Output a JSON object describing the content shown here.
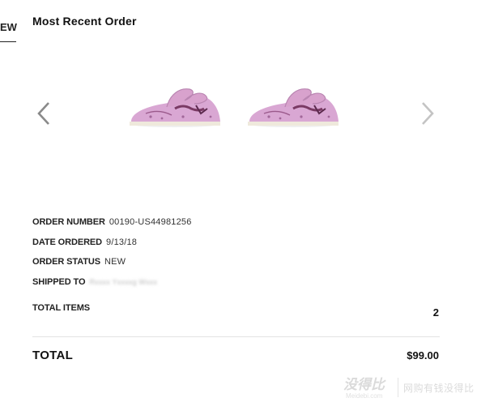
{
  "nav": {
    "left_tab_label": "EW"
  },
  "page": {
    "title": "Most Recent Order"
  },
  "carousel": {
    "prev_icon": "chevron-left-icon",
    "next_icon": "chevron-right-icon",
    "arrow_prev_color": "#8a8a8a",
    "arrow_next_color": "#c4c4c4",
    "shoe_color": "#d9a7d3"
  },
  "order": {
    "number_label": "ORDER NUMBER",
    "number_value": "00190-US44981256",
    "date_label": "DATE ORDERED",
    "date_value": "9/13/18",
    "status_label": "ORDER STATUS",
    "status_value": "NEW",
    "shipped_label": "SHIPPED TO",
    "shipped_value": "Rxxxx Yxxxxg Wxxx"
  },
  "summary": {
    "items_label": "TOTAL ITEMS",
    "items_count": "2",
    "total_label": "TOTAL",
    "total_value": "$99.00"
  },
  "watermark": {
    "main": "没得比",
    "sub": "Meidebi.com",
    "right": "网购有钱没得比"
  }
}
